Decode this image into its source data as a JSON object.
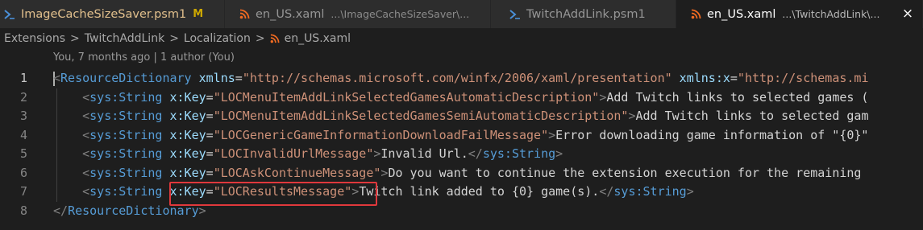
{
  "tabs": [
    {
      "name": "ImageCacheSizeSaver.psm1",
      "modified": "M",
      "icon": "powershell-icon",
      "active": false
    },
    {
      "name": "en_US.xaml",
      "desc": "...\\ImageCacheSizeSaver\\...",
      "icon": "rss-icon",
      "active": false
    },
    {
      "name": "TwitchAddLink.psm1",
      "icon": "powershell-icon",
      "active": false
    },
    {
      "name": "en_US.xaml",
      "desc": "...\\TwitchAddLink\\...",
      "icon": "rss-icon",
      "active": true,
      "close": "×"
    }
  ],
  "breadcrumb": {
    "items": [
      "Extensions",
      "TwitchAddLink",
      "Localization"
    ],
    "file": "en_US.xaml",
    "separator": ">"
  },
  "blame": "You, 7 months ago | 1 author (You)",
  "lines": [
    {
      "n": "1",
      "indent": "",
      "parts": [
        [
          "punc",
          "<"
        ],
        [
          "tag",
          "ResourceDictionary"
        ],
        [
          "txt",
          " "
        ],
        [
          "attr",
          "xmlns"
        ],
        [
          "txt",
          "="
        ],
        [
          "str",
          "\"http://schemas.microsoft.com/winfx/2006/xaml/presentation\""
        ],
        [
          "txt",
          " "
        ],
        [
          "attr",
          "xmlns:x"
        ],
        [
          "txt",
          "="
        ],
        [
          "str",
          "\"http://schemas.mi"
        ]
      ]
    },
    {
      "n": "2",
      "indent": "    ",
      "parts": [
        [
          "punc",
          "<"
        ],
        [
          "tag",
          "sys:String"
        ],
        [
          "txt",
          " "
        ],
        [
          "attr",
          "x:Key"
        ],
        [
          "txt",
          "="
        ],
        [
          "str",
          "\"LOCMenuItemAddLinkSelectedGamesAutomaticDescription\""
        ],
        [
          "punc",
          ">"
        ],
        [
          "txt",
          "Add Twitch links to selected games ("
        ]
      ]
    },
    {
      "n": "3",
      "indent": "    ",
      "parts": [
        [
          "punc",
          "<"
        ],
        [
          "tag",
          "sys:String"
        ],
        [
          "txt",
          " "
        ],
        [
          "attr",
          "x:Key"
        ],
        [
          "txt",
          "="
        ],
        [
          "str",
          "\"LOCMenuItemAddLinkSelectedGamesSemiAutomaticDescription\""
        ],
        [
          "punc",
          ">"
        ],
        [
          "txt",
          "Add Twitch links to selected gam"
        ]
      ]
    },
    {
      "n": "4",
      "indent": "    ",
      "parts": [
        [
          "punc",
          "<"
        ],
        [
          "tag",
          "sys:String"
        ],
        [
          "txt",
          " "
        ],
        [
          "attr",
          "x:Key"
        ],
        [
          "txt",
          "="
        ],
        [
          "str",
          "\"LOCGenericGameInformationDownloadFailMessage\""
        ],
        [
          "punc",
          ">"
        ],
        [
          "txt",
          "Error downloading game information of \"{0}\""
        ]
      ]
    },
    {
      "n": "5",
      "indent": "    ",
      "parts": [
        [
          "punc",
          "<"
        ],
        [
          "tag",
          "sys:String"
        ],
        [
          "txt",
          " "
        ],
        [
          "attr",
          "x:Key"
        ],
        [
          "txt",
          "="
        ],
        [
          "str",
          "\"LOCInvalidUrlMessage\""
        ],
        [
          "punc",
          ">"
        ],
        [
          "txt",
          "Invalid Url."
        ],
        [
          "punc",
          "</"
        ],
        [
          "tag",
          "sys:String"
        ],
        [
          "punc",
          ">"
        ]
      ]
    },
    {
      "n": "6",
      "indent": "    ",
      "parts": [
        [
          "punc",
          "<"
        ],
        [
          "tag",
          "sys:String"
        ],
        [
          "txt",
          " "
        ],
        [
          "attr",
          "x:Key"
        ],
        [
          "txt",
          "="
        ],
        [
          "str",
          "\"LOCAskContinueMessage\""
        ],
        [
          "punc",
          ">"
        ],
        [
          "txt",
          "Do you want to continue the extension execution for the remaining"
        ]
      ]
    },
    {
      "n": "7",
      "indent": "    ",
      "parts": [
        [
          "punc",
          "<"
        ],
        [
          "tag",
          "sys:String"
        ],
        [
          "txt",
          " "
        ],
        [
          "attr",
          "x:Key"
        ],
        [
          "txt",
          "="
        ],
        [
          "str",
          "\"LOCResultsMessage\""
        ],
        [
          "punc",
          ">"
        ],
        [
          "txt",
          "Twitch link added to {0} game(s)."
        ],
        [
          "punc",
          "</"
        ],
        [
          "tag",
          "sys:String"
        ],
        [
          "punc",
          ">"
        ]
      ]
    },
    {
      "n": "8",
      "indent": "",
      "parts": [
        [
          "punc",
          "</"
        ],
        [
          "tag",
          "ResourceDictionary"
        ],
        [
          "punc",
          ">"
        ]
      ]
    }
  ]
}
